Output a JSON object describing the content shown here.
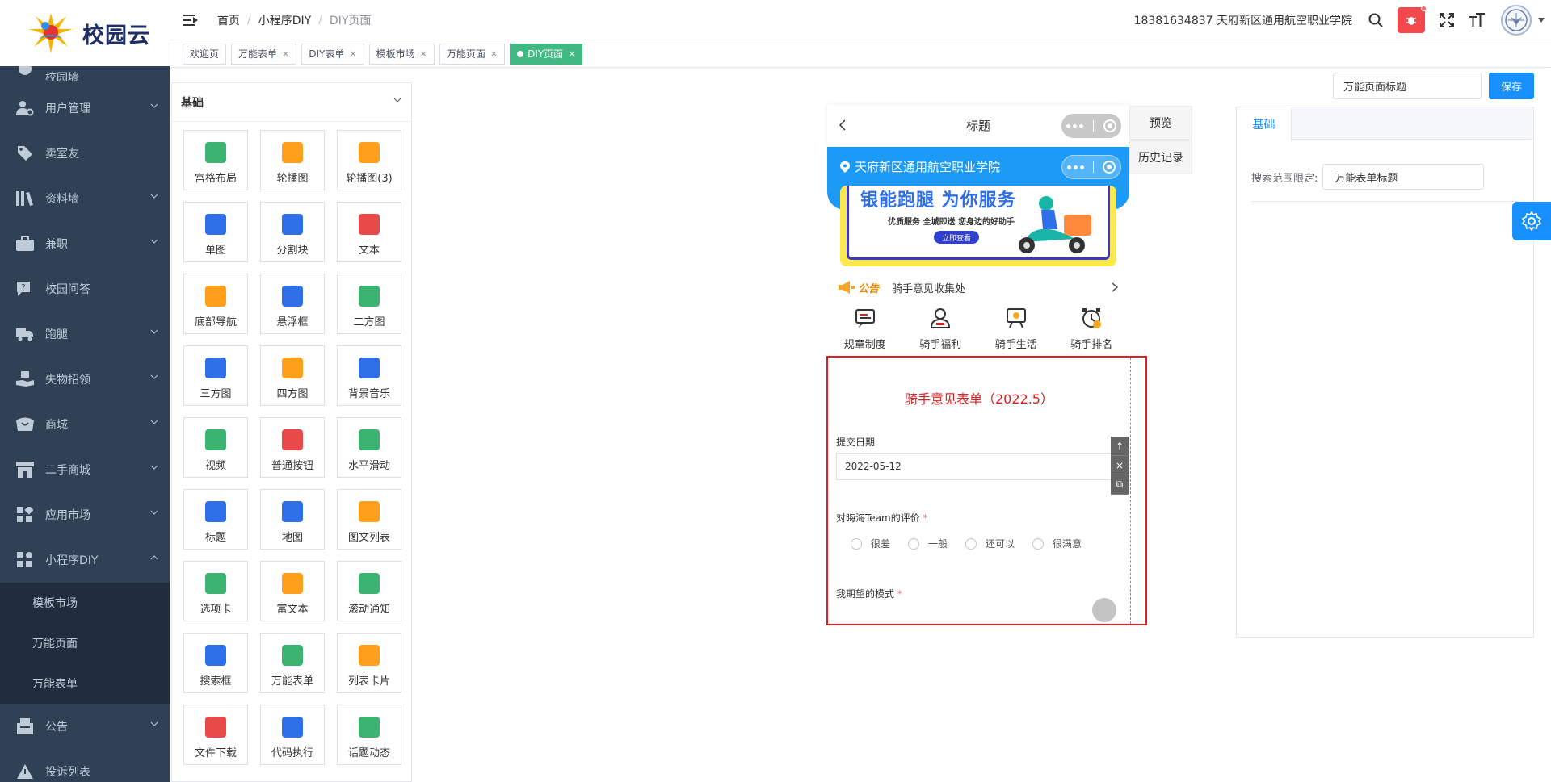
{
  "brand": {
    "title": "校园云"
  },
  "breadcrumb": [
    "首页",
    "小程序DIY",
    "DIY页面"
  ],
  "header": {
    "user_info": "18381634837 天府新区通用航空职业学院"
  },
  "tags": [
    {
      "label": "欢迎页",
      "closable": false,
      "active": false
    },
    {
      "label": "万能表单",
      "closable": true,
      "active": false
    },
    {
      "label": "DIY表单",
      "closable": true,
      "active": false
    },
    {
      "label": "模板市场",
      "closable": true,
      "active": false
    },
    {
      "label": "万能页面",
      "closable": true,
      "active": false
    },
    {
      "label": "DIY页面",
      "closable": true,
      "active": true
    }
  ],
  "sidebar": {
    "partial_top": "校园墙",
    "items": [
      {
        "label": "用户管理",
        "icon": "user-settings-icon",
        "has_children": true
      },
      {
        "label": "卖室友",
        "icon": "tag-icon",
        "has_children": false
      },
      {
        "label": "资料墙",
        "icon": "books-icon",
        "has_children": true
      },
      {
        "label": "兼职",
        "icon": "briefcase-icon",
        "has_children": true
      },
      {
        "label": "校园问答",
        "icon": "question-icon",
        "has_children": false
      },
      {
        "label": "跑腿",
        "icon": "truck-icon",
        "has_children": true
      },
      {
        "label": "失物招领",
        "icon": "hands-icon",
        "has_children": true
      },
      {
        "label": "商城",
        "icon": "shop-icon",
        "has_children": true
      },
      {
        "label": "二手商城",
        "icon": "store-icon",
        "has_children": true
      },
      {
        "label": "应用市场",
        "icon": "apps-icon",
        "has_children": true
      },
      {
        "label": "小程序DIY",
        "icon": "diy-icon",
        "has_children": true,
        "expanded": true
      }
    ],
    "sub_items": [
      "模板市场",
      "万能页面",
      "万能表单"
    ],
    "after_items": [
      {
        "label": "公告",
        "icon": "notice-icon",
        "has_children": true
      },
      {
        "label": "投诉列表",
        "icon": "warning-icon",
        "has_children": false
      }
    ]
  },
  "components": {
    "header": "基础",
    "items": [
      {
        "label": "宫格布局",
        "color": "#3cb371"
      },
      {
        "label": "轮播图",
        "color": "#ff9f1a"
      },
      {
        "label": "轮播图(3)",
        "color": "#ff9f1a"
      },
      {
        "label": "单图",
        "color": "#2f6fe8"
      },
      {
        "label": "分割块",
        "color": "#2f6fe8"
      },
      {
        "label": "文本",
        "color": "#e84a4a"
      },
      {
        "label": "底部导航",
        "color": "#ff9f1a"
      },
      {
        "label": "悬浮框",
        "color": "#2f6fe8"
      },
      {
        "label": "二方图",
        "color": "#3cb371"
      },
      {
        "label": "三方图",
        "color": "#2f6fe8"
      },
      {
        "label": "四方图",
        "color": "#ff9f1a"
      },
      {
        "label": "背景音乐",
        "color": "#2f6fe8"
      },
      {
        "label": "视频",
        "color": "#3cb371"
      },
      {
        "label": "普通按钮",
        "color": "#e84a4a"
      },
      {
        "label": "水平滑动",
        "color": "#3cb371"
      },
      {
        "label": "标题",
        "color": "#2f6fe8"
      },
      {
        "label": "地图",
        "color": "#2f6fe8"
      },
      {
        "label": "图文列表",
        "color": "#ff9f1a"
      },
      {
        "label": "选项卡",
        "color": "#3cb371"
      },
      {
        "label": "富文本",
        "color": "#ff9f1a"
      },
      {
        "label": "滚动通知",
        "color": "#3cb371"
      },
      {
        "label": "搜索框",
        "color": "#2f6fe8"
      },
      {
        "label": "万能表单",
        "color": "#3cb371"
      },
      {
        "label": "列表卡片",
        "color": "#ff9f1a"
      },
      {
        "label": "文件下载",
        "color": "#e84a4a"
      },
      {
        "label": "代码执行",
        "color": "#2f6fe8"
      },
      {
        "label": "话题动态",
        "color": "#3cb371"
      }
    ]
  },
  "phone": {
    "nav_title": "标题",
    "school_name": "天府新区通用航空职业学院",
    "banner": {
      "slogan": "银能跑腿 为你服务",
      "sub": "优质服务  全城即送  您身边的好助手",
      "button": "立即查看"
    },
    "notice": {
      "tag": "公告",
      "text": "骑手意见收集处"
    },
    "quick_links": [
      "规章制度",
      "骑手福利",
      "骑手生活",
      "骑手排名"
    ],
    "form": {
      "title": "骑手意见表单（2022.5）",
      "date_label": "提交日期",
      "date_value": "2022-05-12",
      "rating_label": "对晦海Team的评价",
      "rating_options": [
        "很差",
        "一般",
        "还可以",
        "很满意"
      ],
      "mode_label": "我期望的模式",
      "required_mark": "*"
    },
    "tool_labels": [
      "↑",
      "×",
      "⧉"
    ]
  },
  "side_buttons": {
    "preview": "预览",
    "history": "历史记录"
  },
  "right_panel": {
    "page_title_placeholder": "万能页面标题",
    "save": "保存",
    "tab": "基础",
    "search_scope_label": "搜索范围限定:",
    "search_scope_value": "万能表单标题"
  }
}
